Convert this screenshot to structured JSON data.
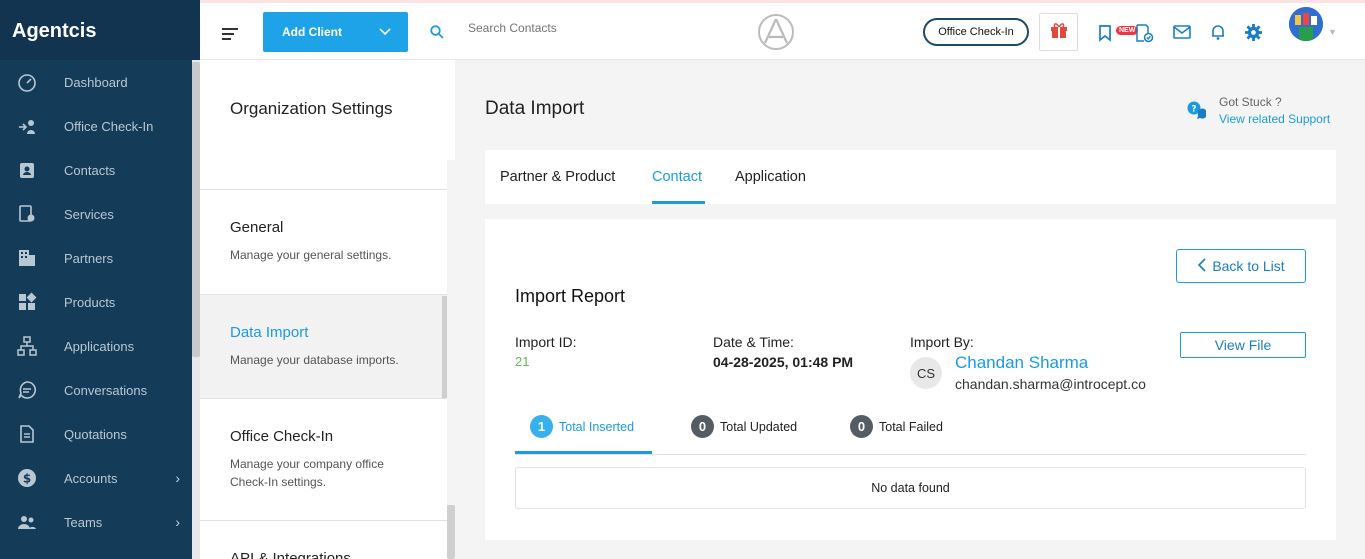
{
  "app": {
    "brand": "Agentcis"
  },
  "sidebar": {
    "items": [
      {
        "label": "Dashboard",
        "icon": "gauge-icon"
      },
      {
        "label": "Office Check-In",
        "icon": "checkin-icon"
      },
      {
        "label": "Contacts",
        "icon": "contact-badge-icon"
      },
      {
        "label": "Services",
        "icon": "services-icon"
      },
      {
        "label": "Partners",
        "icon": "building-icon"
      },
      {
        "label": "Products",
        "icon": "grid-icon"
      },
      {
        "label": "Applications",
        "icon": "workflow-icon"
      },
      {
        "label": "Conversations",
        "icon": "chat-icon"
      },
      {
        "label": "Quotations",
        "icon": "document-icon"
      },
      {
        "label": "Accounts",
        "icon": "dollar-icon",
        "has_children": true
      },
      {
        "label": "Teams",
        "icon": "people-icon",
        "has_children": true
      }
    ]
  },
  "topbar": {
    "add_client": "Add Client",
    "search_placeholder": "Search Contacts",
    "office_checkin": "Office Check-In",
    "new_badge": "NEW"
  },
  "settings": {
    "title": "Organization Settings",
    "items": [
      {
        "title": "General",
        "desc": "Manage your general settings."
      },
      {
        "title": "Data Import",
        "desc": "Manage your database imports.",
        "active": true
      },
      {
        "title": "Office Check-In",
        "desc": "Manage your company office Check-In settings."
      },
      {
        "title": "API & Integrations",
        "desc": ""
      }
    ]
  },
  "main": {
    "title": "Data Import",
    "help": {
      "line1": "Got Stuck ?",
      "line2": "View related Support"
    },
    "tabs": [
      "Partner & Product",
      "Contact",
      "Application"
    ],
    "active_tab": "Contact"
  },
  "report": {
    "back_label": "Back to List",
    "title": "Import Report",
    "import_id_label": "Import ID:",
    "import_id": "21",
    "date_label": "Date & Time:",
    "date": "04-28-2025, 01:48 PM",
    "by_label": "Import By:",
    "by_initials": "CS",
    "by_name": "Chandan Sharma",
    "by_email": "chandan.sharma@introcept.co",
    "view_file": "View File",
    "stats": [
      {
        "count": "1",
        "label": "Total Inserted",
        "active": true
      },
      {
        "count": "0",
        "label": "Total Updated"
      },
      {
        "count": "0",
        "label": "Total Failed"
      }
    ],
    "empty_text": "No data found"
  },
  "colors": {
    "accent": "#1a9be0",
    "sidebar": "#143b57",
    "success": "#5cb85c"
  }
}
